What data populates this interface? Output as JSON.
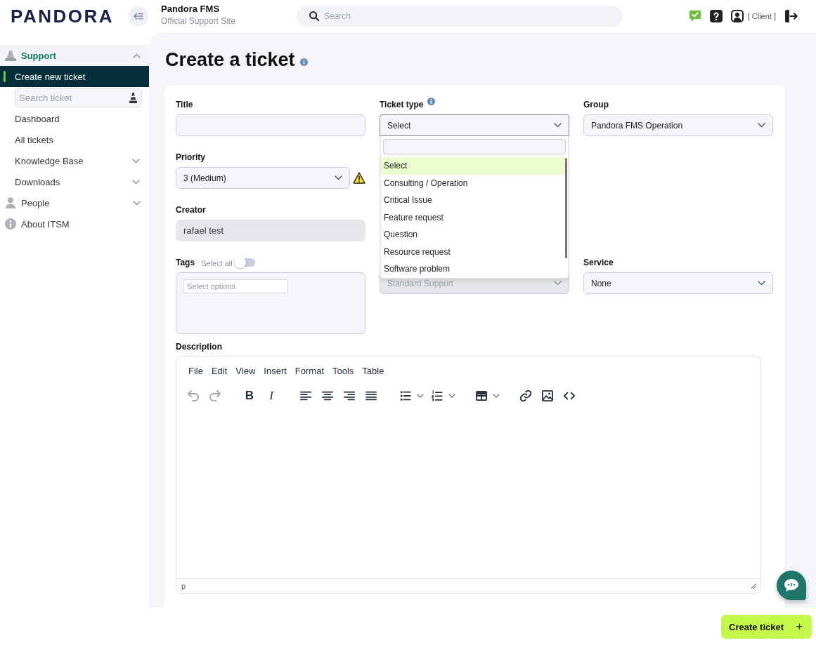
{
  "header": {
    "logo": "PANDORA",
    "title": "Pandora FMS",
    "subtitle": "Official Support Site",
    "search": {
      "placeholder": "Search"
    },
    "account": "[ Client ]"
  },
  "sidebar": {
    "items": [
      {
        "kind": "section",
        "label": "Support",
        "selected": true,
        "expanded": true,
        "children": [
          {
            "kind": "link",
            "label": "Create new ticket",
            "selected": true
          },
          {
            "kind": "search",
            "placeholder": "Search ticket"
          },
          {
            "kind": "link",
            "label": "Dashboard",
            "selected": false
          },
          {
            "kind": "link",
            "label": "All tickets",
            "selected": false
          },
          {
            "kind": "group",
            "label": "Knowledge Base",
            "selected": false,
            "expanded": false
          },
          {
            "kind": "group",
            "label": "Downloads",
            "selected": false,
            "expanded": false
          }
        ]
      },
      {
        "kind": "section",
        "label": "People",
        "selected": false,
        "expanded": false
      },
      {
        "kind": "section",
        "label": "About ITSM",
        "selected": false
      }
    ]
  },
  "page": {
    "title": "Create a ticket"
  },
  "form": {
    "rows": [
      [
        {
          "kind": "text",
          "label": "Title",
          "disabled": false
        },
        {
          "kind": "select",
          "label": "Ticket type",
          "info": true,
          "value": "Select",
          "disabled": false,
          "open": true,
          "options": [
            {
              "label": "Select",
              "selected": true
            },
            {
              "label": "Consulting / Operation",
              "selected": false
            },
            {
              "label": "Critical Issue",
              "selected": false
            },
            {
              "label": "Feature request",
              "selected": false
            },
            {
              "label": "Question",
              "selected": false
            },
            {
              "label": "Resource request",
              "selected": false
            },
            {
              "label": "Software problem",
              "selected": false
            }
          ]
        },
        {
          "kind": "select",
          "label": "Group",
          "value": "Pandora FMS Operation",
          "disabled": false,
          "open": false
        }
      ],
      [
        {
          "kind": "select",
          "label": "Priority",
          "value": "3 (Medium)",
          "warning": true,
          "disabled": false,
          "open": false
        },
        null,
        null
      ],
      [
        {
          "kind": "text",
          "label": "Creator",
          "value": "rafael test",
          "disabled": true
        },
        null,
        null
      ],
      [
        {
          "kind": "tags",
          "label": "Tags",
          "select_all": {
            "label": "Select all",
            "on": false
          },
          "placeholder": "Select options",
          "disabled": false
        },
        {
          "kind": "select",
          "value": "Standard Support",
          "disabled": true,
          "open": false
        },
        {
          "kind": "select",
          "label": "Service",
          "value": "None",
          "disabled": false,
          "open": false
        }
      ]
    ],
    "description": {
      "label": "Description",
      "menu": [
        "File",
        "Edit",
        "View",
        "Insert",
        "Format",
        "Tools",
        "Table"
      ],
      "toolbar": [
        [
          {
            "kind": "undo",
            "disabled": true
          },
          {
            "kind": "redo",
            "disabled": true
          }
        ],
        [
          {
            "kind": "bold",
            "label": "B",
            "disabled": false
          },
          {
            "kind": "italic",
            "label": "I",
            "disabled": false
          }
        ],
        [
          {
            "kind": "align-left",
            "disabled": false
          },
          {
            "kind": "align-center",
            "disabled": false
          },
          {
            "kind": "align-right",
            "disabled": false
          },
          {
            "kind": "justify",
            "disabled": false
          }
        ],
        [
          {
            "kind": "bullet-list",
            "disabled": false
          },
          {
            "kind": "numbered-list",
            "disabled": false
          }
        ],
        [
          {
            "kind": "table",
            "disabled": false
          }
        ],
        [
          {
            "kind": "link",
            "disabled": false
          },
          {
            "kind": "image",
            "disabled": false
          },
          {
            "kind": "code",
            "disabled": false
          }
        ]
      ],
      "path": "p"
    }
  },
  "footer": {
    "submit": {
      "label": "Create ticket",
      "icon": "+"
    }
  }
}
